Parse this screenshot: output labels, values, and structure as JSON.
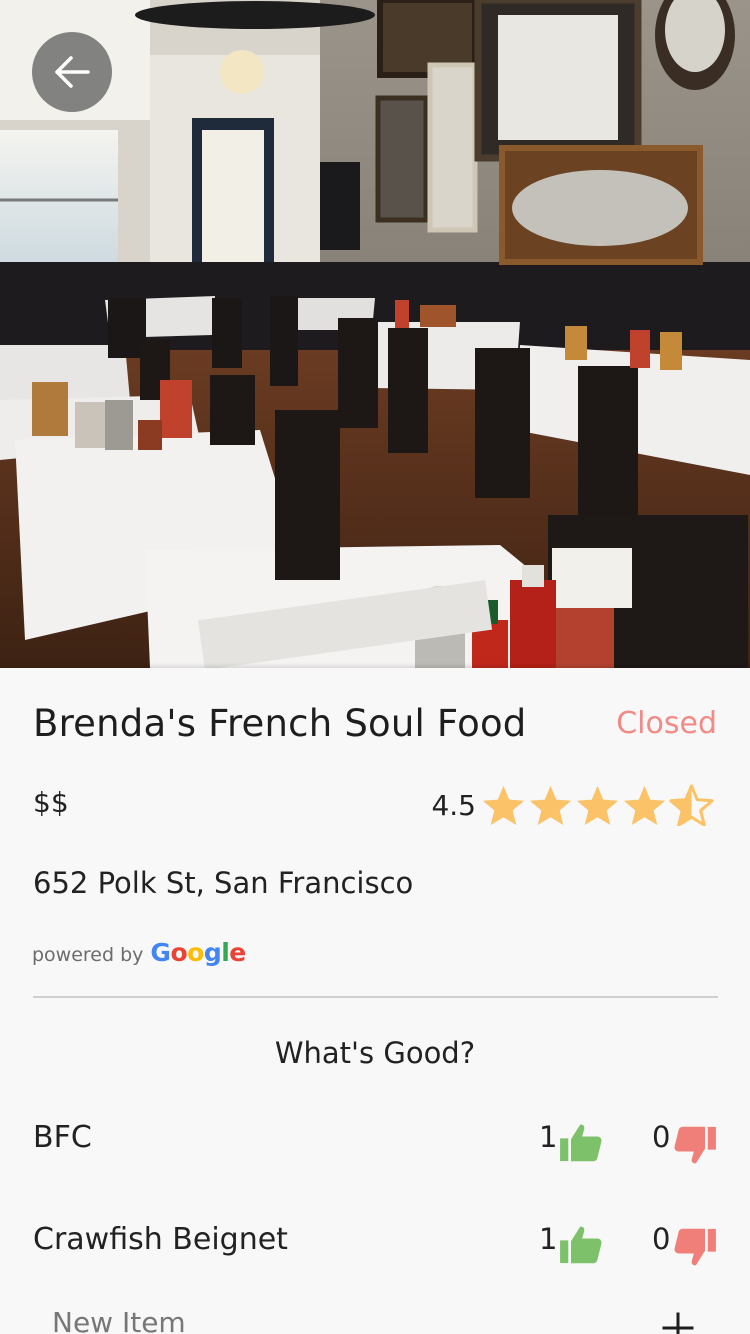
{
  "restaurant": {
    "name": "Brenda's French Soul Food",
    "status": "Closed",
    "price": "$$",
    "rating": "4.5",
    "rating_stars": 4.5,
    "address": "652 Polk St, San Francisco"
  },
  "attribution": {
    "powered_by": "powered by",
    "google": [
      "G",
      "o",
      "o",
      "g",
      "l",
      "e"
    ]
  },
  "section": {
    "title": "What's Good?"
  },
  "items": [
    {
      "name": "BFC",
      "upvotes": "1",
      "downvotes": "0"
    },
    {
      "name": "Crawfish Beignet",
      "upvotes": "1",
      "downvotes": "0"
    }
  ],
  "new_item": {
    "placeholder": "New Item"
  },
  "colors": {
    "status_closed": "#f28b86",
    "star": "#fbc267",
    "thumbs_up": "#7dc26b",
    "thumbs_down": "#f07f7a"
  },
  "icons": {
    "back": "arrow-left-icon",
    "up": "thumbs-up-icon",
    "down": "thumbs-down-icon",
    "add": "plus-icon"
  }
}
